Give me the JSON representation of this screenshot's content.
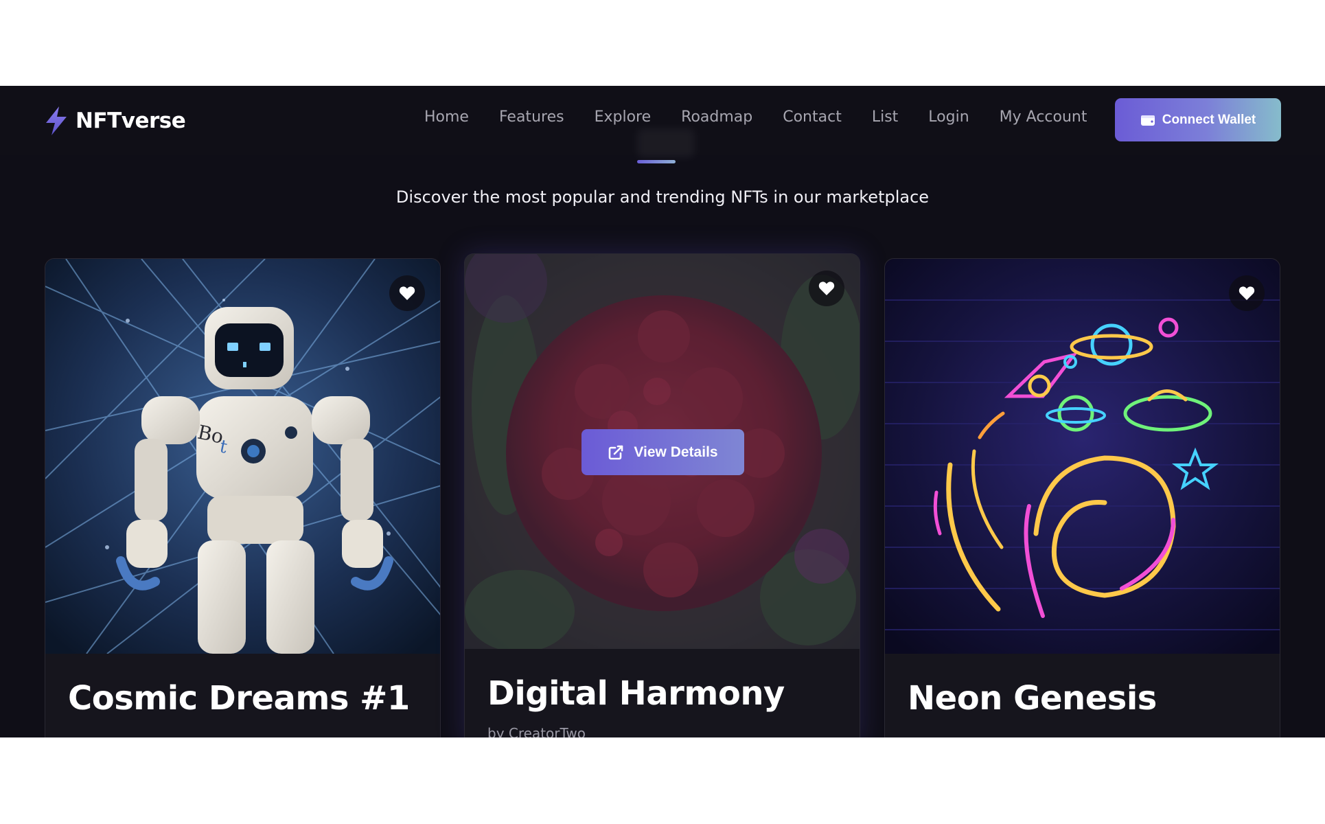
{
  "brand": {
    "name": "NFTverse",
    "accent": "#6b5cd6"
  },
  "nav": {
    "links": [
      "Home",
      "Features",
      "Explore",
      "Roadmap",
      "Contact",
      "List",
      "Login",
      "My Account"
    ],
    "wallet_button": "Connect Wallet"
  },
  "section": {
    "subtitle": "Discover the most popular and trending NFTs in our marketplace"
  },
  "cards": [
    {
      "title": "Cosmic Dreams #1",
      "creator": "",
      "image": "robot-bot-artwork",
      "hovered": false
    },
    {
      "title": "Digital Harmony",
      "creator": "by CreatorTwo",
      "image": "red-flower-artwork",
      "hovered": true,
      "overlay_button": "View Details"
    },
    {
      "title": "Neon Genesis",
      "creator": "",
      "image": "neon-space-artwork",
      "hovered": false
    }
  ]
}
